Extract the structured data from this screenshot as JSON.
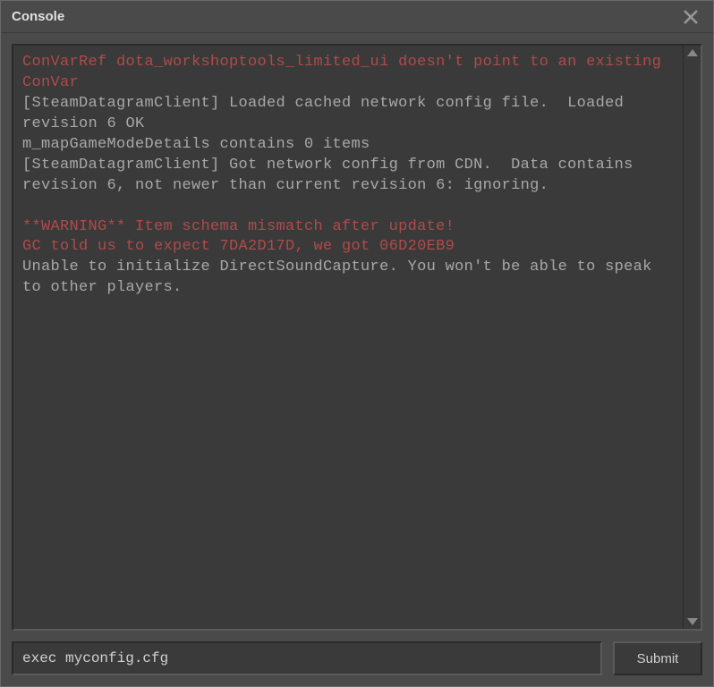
{
  "window": {
    "title": "Console"
  },
  "output": {
    "lines": [
      {
        "cls": "red",
        "text": "ConVarRef dota_workshoptools_limited_ui doesn't point to an existing ConVar"
      },
      {
        "cls": "normal",
        "text": "[SteamDatagramClient] Loaded cached network config file.  Loaded revision 6 OK"
      },
      {
        "cls": "normal",
        "text": "m_mapGameModeDetails contains 0 items"
      },
      {
        "cls": "normal",
        "text": "[SteamDatagramClient] Got network config from CDN.  Data contains revision 6, not newer than current revision 6: ignoring."
      },
      {
        "cls": "normal",
        "text": ""
      },
      {
        "cls": "red",
        "text": "**WARNING** Item schema mismatch after update!"
      },
      {
        "cls": "red",
        "text": "GC told us to expect 7DA2D17D, we got 06D20EB9"
      },
      {
        "cls": "normal",
        "text": "Unable to initialize DirectSoundCapture. You won't be able to speak to other players."
      }
    ]
  },
  "input": {
    "value": "exec myconfig.cfg",
    "submit_label": "Submit"
  }
}
